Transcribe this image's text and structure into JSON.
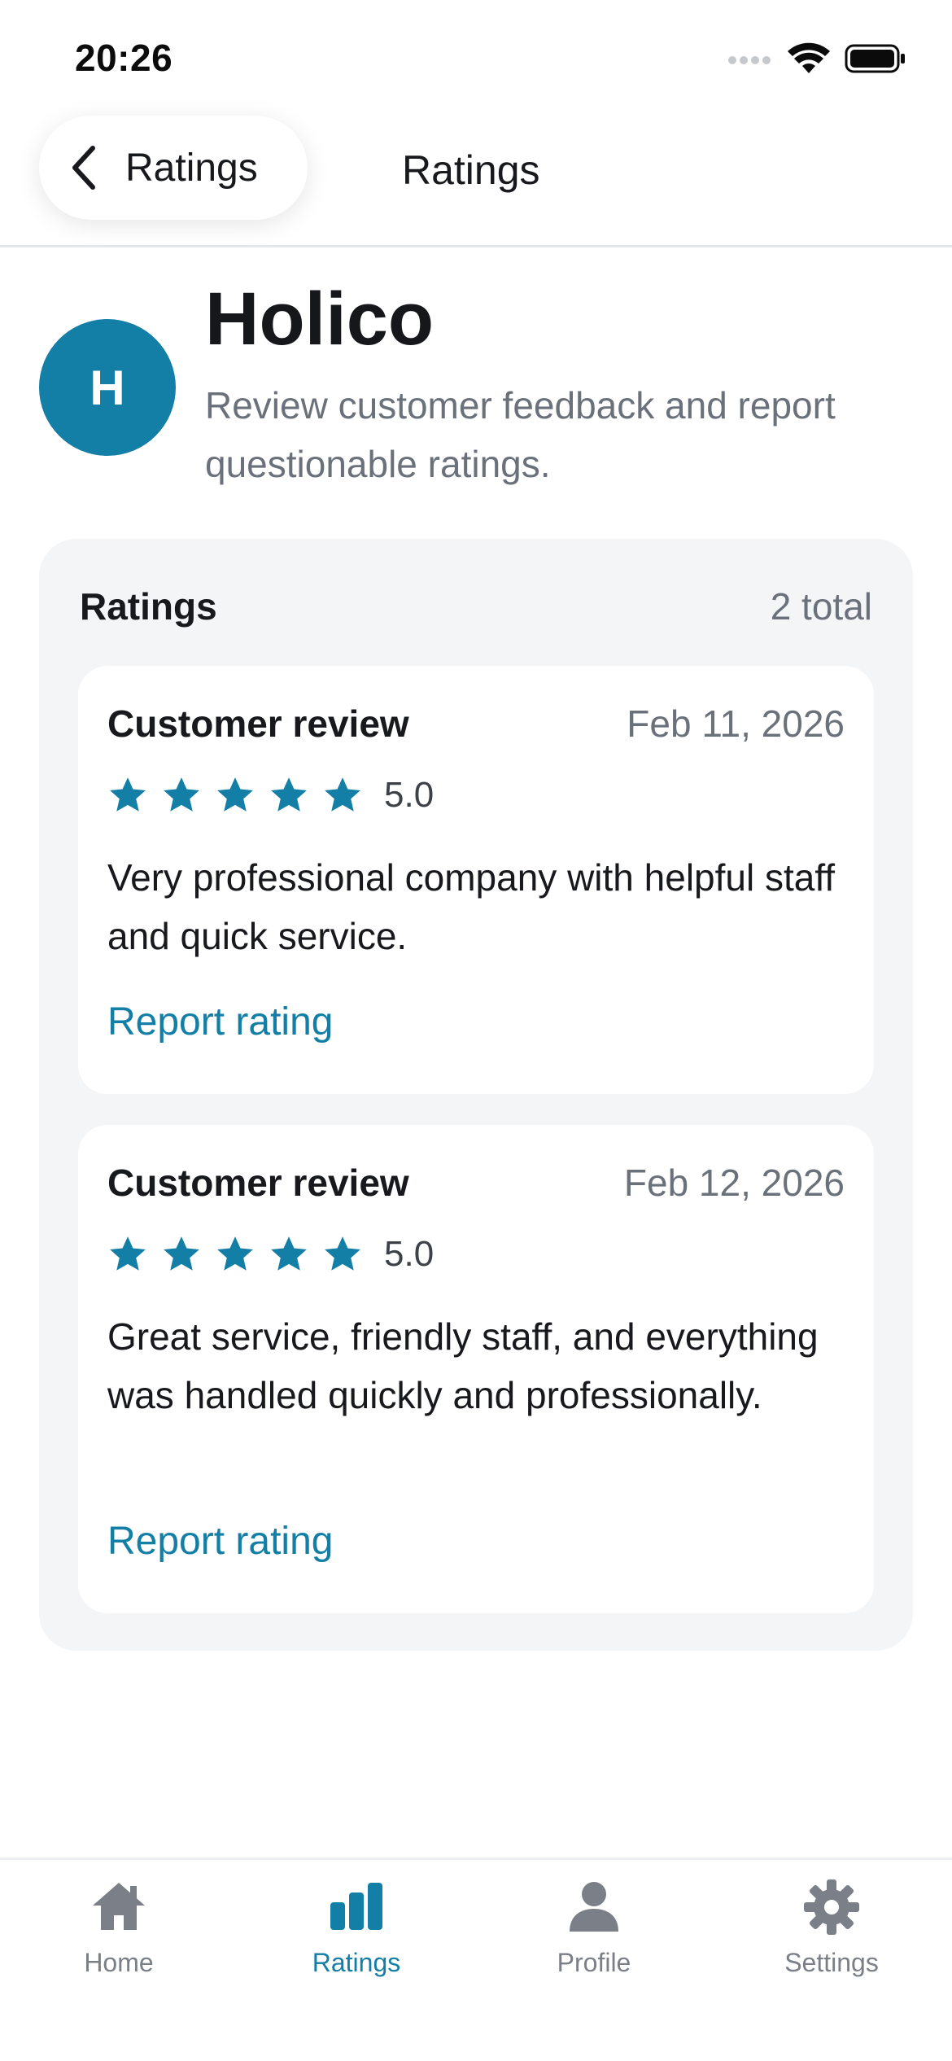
{
  "status_bar": {
    "time": "20:26"
  },
  "nav": {
    "back_label": "Ratings",
    "title": "Ratings"
  },
  "company": {
    "avatar_letter": "H",
    "name": "Holico",
    "subtitle": "Review customer feedback and report questionable ratings."
  },
  "ratings": {
    "title": "Ratings",
    "count": "2 total",
    "items": [
      {
        "title": "Customer review",
        "date": "Feb 11, 2026",
        "stars": 5,
        "score": "5.0",
        "text": "Very professional company with helpful staff and quick service.",
        "report_label": "Report rating"
      },
      {
        "title": "Customer review",
        "date": "Feb 12, 2026",
        "stars": 5,
        "score": "5.0",
        "text": "Great service, friendly staff, and everything was handled quickly and professionally.",
        "report_label": "Report rating"
      }
    ]
  },
  "tab_bar": {
    "active": "ratings",
    "items": [
      {
        "id": "home",
        "label": "Home",
        "icon": "home-icon"
      },
      {
        "id": "ratings",
        "label": "Ratings",
        "icon": "bar-chart-icon"
      },
      {
        "id": "profile",
        "label": "Profile",
        "icon": "person-icon"
      },
      {
        "id": "settings",
        "label": "Settings",
        "icon": "gear-icon"
      }
    ]
  },
  "colors": {
    "accent": "#137ea6",
    "muted_text": "#6b717b",
    "panel_bg": "#f4f5f7",
    "inactive_tab": "#7b8088"
  }
}
